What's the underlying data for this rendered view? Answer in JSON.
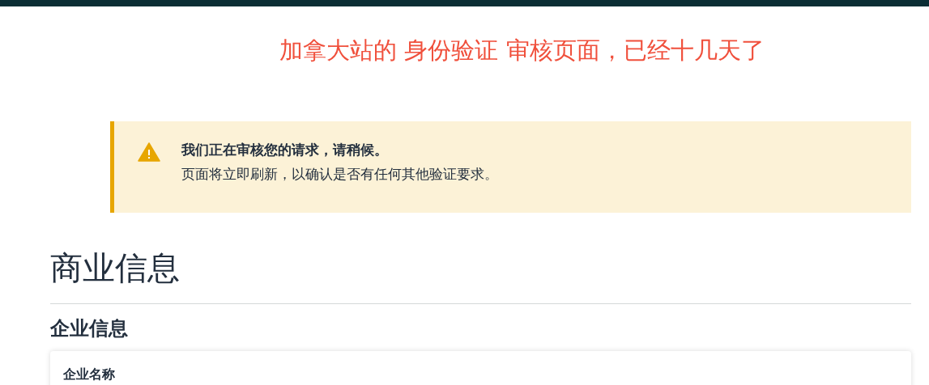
{
  "annotation": {
    "text": "加拿大站的 身份验证 审核页面，已经十几天了"
  },
  "alert": {
    "title": "我们正在审核您的请求，请稍候。",
    "message": "页面将立即刷新，以确认是否有任何其他验证要求。"
  },
  "page_title": "商业信息",
  "section": {
    "title": "企业信息",
    "card": {
      "label": "企业名称"
    }
  }
}
